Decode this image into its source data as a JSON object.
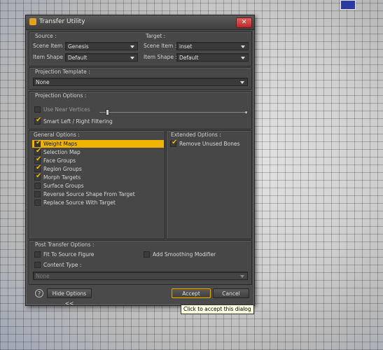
{
  "window": {
    "title": "Transfer Utility",
    "close_glyph": "✕"
  },
  "source": {
    "label": "Source :",
    "scene_item_label": "Scene Item :",
    "scene_item_value": "Genesis",
    "item_shape_label": "Item Shape :",
    "item_shape_value": "Default"
  },
  "target": {
    "label": "Target :",
    "scene_item_label": "Scene Item :",
    "scene_item_value": "inset",
    "item_shape_label": "Item Shape :",
    "item_shape_value": "Default"
  },
  "projection_template": {
    "label": "Projection Template :",
    "value": "None"
  },
  "projection_options": {
    "label": "Projection Options :",
    "use_near_vertices": {
      "label": "Use Near Vertices",
      "checked": false
    },
    "smart_filtering": {
      "label": "Smart Left / Right Filtering",
      "checked": true
    }
  },
  "general_options": {
    "label": "General Options :",
    "items": [
      {
        "label": "Weight Maps",
        "checked": true,
        "selected": true
      },
      {
        "label": "Selection Map",
        "checked": true
      },
      {
        "label": "Face Groups",
        "checked": true
      },
      {
        "label": "Region Groups",
        "checked": true
      },
      {
        "label": "Morph Targets",
        "checked": true
      },
      {
        "label": "Surface Groups",
        "checked": false
      },
      {
        "label": "Reverse Source Shape From Target",
        "checked": false
      },
      {
        "label": "Replace Source With Target",
        "checked": false
      }
    ]
  },
  "extended_options": {
    "label": "Extended Options :",
    "remove_unused_bones": {
      "label": "Remove Unused Bones",
      "checked": true
    }
  },
  "post_transfer": {
    "label": "Post Transfer Options :",
    "fit_to_source": {
      "label": "Fit To Source Figure",
      "checked": false
    },
    "add_smoothing": {
      "label": "Add Smoothing Modifier",
      "checked": false
    },
    "content_type": {
      "label": "Content Type :",
      "checked": false,
      "value": "None"
    }
  },
  "footer": {
    "help_glyph": "?",
    "hide_options_label": "Hide Options <<",
    "accept_label": "Accept",
    "cancel_label": "Cancel"
  },
  "tooltip": "Click to accept this dialog",
  "colors": {
    "accent": "#f0b400",
    "dialog_bg": "#4a4a4a"
  }
}
